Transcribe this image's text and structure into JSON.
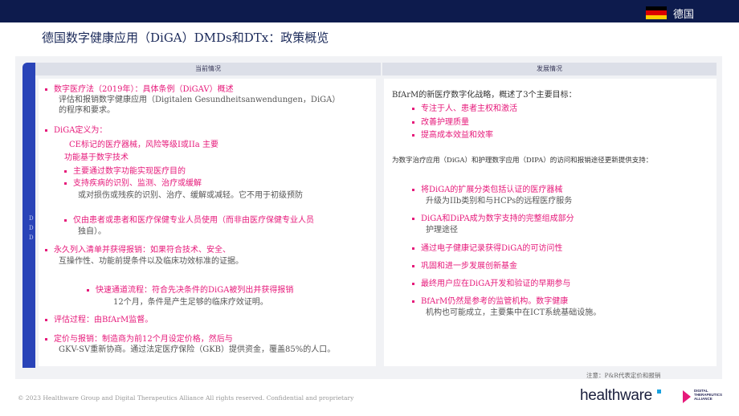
{
  "header": {
    "country": "德国",
    "flag_colors": [
      "#000000",
      "#dd0000",
      "#ffce00"
    ],
    "title": "德国数字健康应用（DiGA）DMDs和DTx：政策概览"
  },
  "columns": {
    "left_header": "当前情况",
    "right_header": "发展情况"
  },
  "side_stripe_text": [
    "D",
    "D",
    "D"
  ],
  "left": {
    "l1": "数字医疗法（2019年）：具体条例（DiGAV）概述",
    "l2": "评估和报销数字健康应用（Digitalen Gesundheitsanwendungen，DiGA）",
    "l3": "的程序和要求。",
    "l4": "DiGA定义为：",
    "l5": "CE标记的医疗器械，风险等级I或IIa  主要",
    "l6": "功能基于数字技术",
    "l7": "主要通过数字功能实现医疗目的",
    "l8": "支持疾病的识别、监测、治疗或缓解",
    "l9": "或对损伤或残疾的识别、治疗、缓解或减轻。它不用于初级预防",
    "l10": "仅由患者或患者和医疗保健专业人员使用（而非由医疗保健专业人员",
    "l11": "独自）。",
    "l12": "永久列入清单并获得报销：如果符合技术、安全、",
    "l13": "互操作性、功能前提条件以及临床功效标准的证据。",
    "l14": "快速通道流程：符合先决条件的DiGA被列出并获得报销",
    "l15": "12个月，条件是产生足够的临床疗效证明。",
    "l16": "评估过程：由BfArM监督。",
    "l17": "定价与报销：制造商为前12个月设定价格，然后与",
    "l18": "GKV-SV重新协商。通过法定医疗保险（GKB）提供资金，覆盖85%的人口。"
  },
  "right": {
    "r1": "BfArM的新医疗数字化战略，概述了3个主要目标：",
    "r2": "专注于人、患者主权和激活",
    "r3": "改善护理质量",
    "r4": "提高成本效益和效率",
    "r5": "为数字治疗应用（DiGA）和护理数字应用（DIPA）的访问和报销途径更新提供支持：",
    "r6": "将DiGA的扩展分类包括认证的医疗器械",
    "r7": "升级为IIb类别和与HCPs的远程医疗服务",
    "r8": "DiGA和DiPA成为数字支持的完整组成部分",
    "r9": "护理途径",
    "r10": "通过电子健康记录获得DiGA的可访问性",
    "r11": "巩固和进一步发展创新基金",
    "r12": "最终用户应在DiGA开发和验证的早期参与",
    "r13": "BfArM仍然是参考的监管机构。数字健康",
    "r14": "机构也可能成立，主要集中在ICT系统基础设施。"
  },
  "note": "注意：P&R代表定价和报销",
  "footer": "© 2023 Healthware Group and Digital Therapeutics Alliance All rights reserved. Confidential and proprietary",
  "logos": {
    "healthware": "healthware",
    "dta": [
      "DIGITAL",
      "THERAPEUTICS",
      "ALLIANCE"
    ]
  },
  "colors": {
    "navy": "#0d1b4d",
    "accent_pink": "#e6197a",
    "stripe_blue": "#2a44b8"
  }
}
